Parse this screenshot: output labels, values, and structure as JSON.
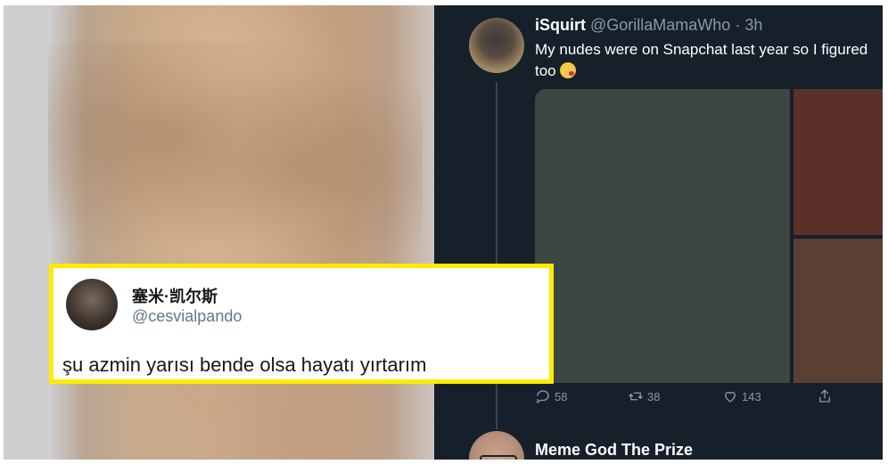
{
  "main_tweet": {
    "display_name": "iSquirt",
    "handle": "@GorillaMamaWho",
    "timestamp": "3h",
    "text_line1": "My nudes were on Snapchat last year so I figured",
    "text_line2": "too",
    "emoji": "kissing-face-emoji",
    "counts": {
      "replies": "58",
      "retweets": "38",
      "likes": "143"
    }
  },
  "reply_tweet": {
    "display_name": "Meme God The Prize"
  },
  "quote_card": {
    "display_name": "塞米·凯尔斯",
    "handle": "@cesvialpando",
    "text": "şu azmin yarısı bende olsa hayatı yırtarım",
    "border_color": "#ffeb00"
  },
  "colors": {
    "dark_bg": "#15202b",
    "muted": "#8899a6",
    "thread_line": "#38444d"
  }
}
